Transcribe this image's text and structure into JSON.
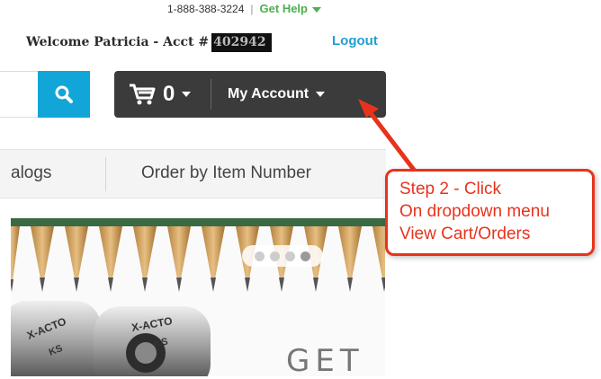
{
  "header": {
    "phone": "1-888-388-3224",
    "separator": "|",
    "help_label": "Get Help",
    "welcome_text": "Welcome Patricia  -  Acct #",
    "acct_number": "402942",
    "logout_label": "Logout"
  },
  "toolbar": {
    "cart_count": "0",
    "my_account_label": "My Account"
  },
  "nav": {
    "catalogs_label": "alogs",
    "order_by_item_label": "Order by Item Number"
  },
  "banner": {
    "slide_count": 4,
    "active_slide": 4,
    "headline": "GET",
    "brand_label": "X-ACTO",
    "model_label": "KS"
  },
  "annotation": {
    "line1": "Step 2 - Click",
    "line2": "On dropdown menu",
    "line3": "View Cart/Orders"
  },
  "colors": {
    "accent_blue": "#12a5d8",
    "help_green": "#4caf50",
    "bar_dark": "#3b3b3b",
    "annotation_red": "#e8331c"
  },
  "icons": [
    "search-icon",
    "cart-icon",
    "chevron-down-icon",
    "arrow-pointer"
  ]
}
